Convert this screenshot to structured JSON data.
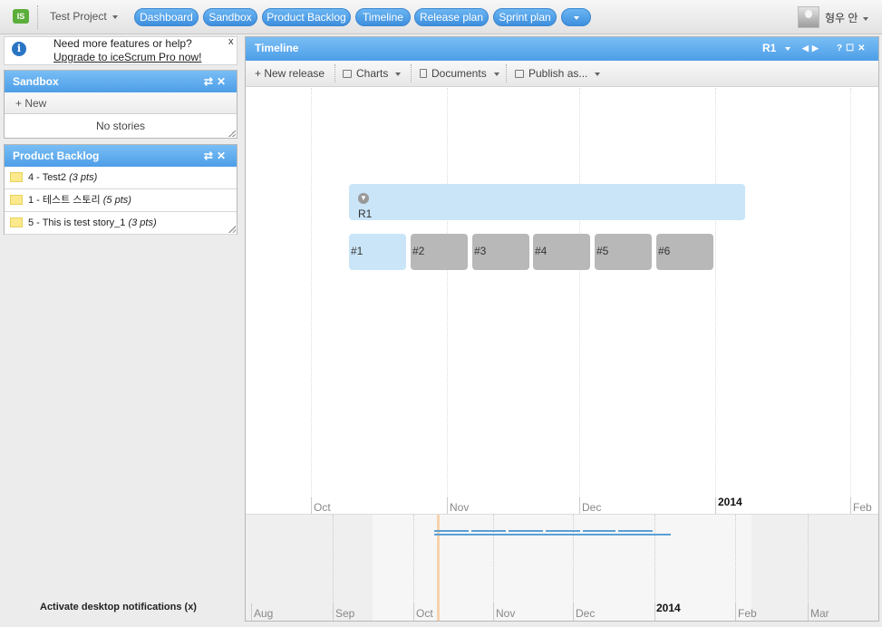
{
  "app": {
    "logo_text": "IS",
    "project": "Test Project",
    "user": "형우 안"
  },
  "nav": {
    "items": [
      "Dashboard",
      "Sandbox",
      "Product Backlog",
      "Timeline",
      "Release plan",
      "Sprint plan"
    ]
  },
  "notice": {
    "text": "Need more features or help?",
    "link": "Upgrade to iceScrum Pro now!",
    "close": "x"
  },
  "sandbox": {
    "title": "Sandbox",
    "new_label": "New",
    "empty": "No stories"
  },
  "backlog": {
    "title": "Product Backlog",
    "stories": [
      {
        "label": "4 - Test2",
        "pts": "(3 pts)"
      },
      {
        "label": "1 - 테스트 스토리",
        "pts": "(5 pts)"
      },
      {
        "label": "5 - This is test story_1",
        "pts": "(3 pts)"
      }
    ]
  },
  "desktop_notifications": "Activate desktop notifications (x)",
  "timeline": {
    "title": "Timeline",
    "release_selector": "R1",
    "toolbar": {
      "new_release": "New release",
      "charts": "Charts",
      "documents": "Documents",
      "publish": "Publish as..."
    },
    "release": {
      "name": "R1"
    },
    "sprints": [
      "#1",
      "#2",
      "#3",
      "#4",
      "#5",
      "#6"
    ],
    "months": [
      "Oct",
      "Nov",
      "Dec",
      "2014",
      "Feb"
    ],
    "overview_months": [
      "Aug",
      "Sep",
      "Oct",
      "Nov",
      "Dec",
      "2014",
      "Feb",
      "Mar"
    ]
  }
}
